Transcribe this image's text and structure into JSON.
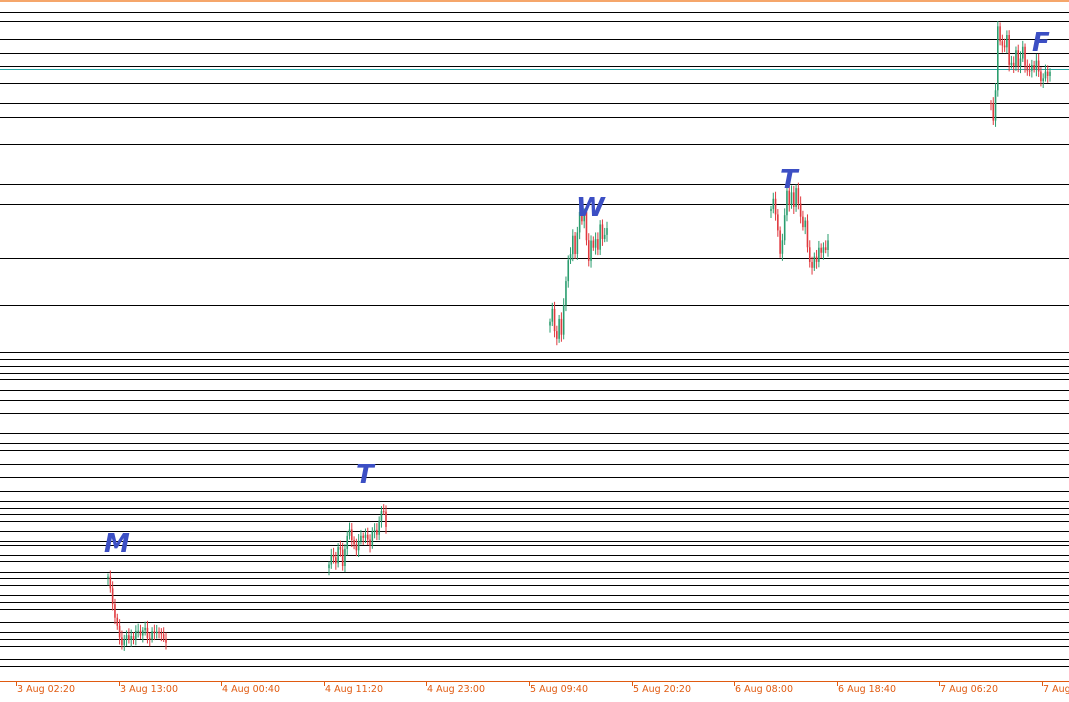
{
  "chart_data": {
    "type": "candlestick",
    "x_tick_labels": [
      "3 Aug 02:20",
      "3 Aug 13:00",
      "4 Aug 00:40",
      "4 Aug 11:20",
      "4 Aug 23:00",
      "5 Aug 09:40",
      "5 Aug 20:20",
      "6 Aug 08:00",
      "6 Aug 18:40",
      "7 Aug 06:20",
      "7 Aug"
    ],
    "day_labels": [
      {
        "text": "M",
        "anchor": "3 Aug 13:00"
      },
      {
        "text": "T",
        "anchor": "4 Aug 11:20"
      },
      {
        "text": "W",
        "anchor": "5 Aug 09:40"
      },
      {
        "text": "T",
        "anchor": "6 Aug 08:00"
      },
      {
        "text": "F",
        "anchor": "7 Aug 06:20"
      }
    ],
    "ylim": [
      0,
      100
    ],
    "horizontal_levels": [
      98.5,
      97.2,
      94.5,
      92.5,
      90.5,
      88.0,
      85.0,
      83.0,
      79.0,
      73.0,
      70.0,
      62.0,
      55.0,
      48.0,
      47.0,
      46.0,
      45.0,
      44.0,
      42.5,
      41.0,
      39.0,
      36.0,
      34.5,
      33.5,
      31.5,
      29.5,
      27.5,
      26.0,
      25.0,
      24.0,
      23.0,
      21.5,
      20.0,
      19.5,
      18.0,
      17.0,
      15.5,
      14.5,
      13.5,
      12.0,
      11.0,
      10.0,
      8.0,
      6.5,
      5.5,
      4.5,
      2.5,
      1.5
    ],
    "current_price_level": 90.0,
    "segments": [
      {
        "day": "M",
        "points": [
          [
            0.0,
            14.5
          ],
          [
            0.05,
            12.0
          ],
          [
            0.1,
            10.0
          ],
          [
            0.15,
            8.0
          ],
          [
            0.2,
            5.5
          ],
          [
            0.25,
            4.5
          ],
          [
            0.3,
            6.0
          ],
          [
            0.35,
            5.0
          ],
          [
            0.4,
            6.5
          ],
          [
            0.45,
            5.5
          ],
          [
            0.5,
            7.0
          ],
          [
            0.55,
            6.0
          ],
          [
            0.6,
            6.5
          ],
          [
            0.65,
            7.0
          ],
          [
            0.7,
            5.5
          ],
          [
            0.75,
            6.5
          ],
          [
            0.8,
            6.0
          ],
          [
            0.85,
            6.8
          ],
          [
            0.9,
            6.0
          ],
          [
            0.95,
            5.8
          ],
          [
            1.0,
            5.5
          ]
        ]
      },
      {
        "day": "T",
        "points": [
          [
            0.0,
            16.0
          ],
          [
            0.06,
            18.5
          ],
          [
            0.12,
            17.0
          ],
          [
            0.18,
            20.0
          ],
          [
            0.24,
            16.5
          ],
          [
            0.3,
            19.5
          ],
          [
            0.36,
            22.0
          ],
          [
            0.42,
            20.0
          ],
          [
            0.48,
            18.5
          ],
          [
            0.54,
            21.0
          ],
          [
            0.6,
            20.0
          ],
          [
            0.66,
            21.5
          ],
          [
            0.72,
            19.5
          ],
          [
            0.78,
            22.0
          ],
          [
            0.84,
            21.0
          ],
          [
            0.9,
            23.5
          ],
          [
            0.95,
            25.5
          ],
          [
            1.0,
            22.5
          ]
        ]
      },
      {
        "day": "W",
        "points": [
          [
            0.0,
            52.0
          ],
          [
            0.04,
            54.5
          ],
          [
            0.08,
            51.5
          ],
          [
            0.12,
            50.0
          ],
          [
            0.16,
            53.0
          ],
          [
            0.2,
            51.0
          ],
          [
            0.24,
            55.0
          ],
          [
            0.28,
            58.0
          ],
          [
            0.32,
            61.5
          ],
          [
            0.36,
            63.0
          ],
          [
            0.4,
            65.5
          ],
          [
            0.44,
            62.5
          ],
          [
            0.48,
            66.0
          ],
          [
            0.52,
            69.0
          ],
          [
            0.56,
            67.0
          ],
          [
            0.6,
            68.5
          ],
          [
            0.64,
            65.0
          ],
          [
            0.68,
            62.0
          ],
          [
            0.72,
            64.5
          ],
          [
            0.76,
            63.5
          ],
          [
            0.8,
            65.0
          ],
          [
            0.84,
            63.0
          ],
          [
            0.88,
            66.5
          ],
          [
            0.92,
            65.0
          ],
          [
            0.96,
            66.0
          ],
          [
            1.0,
            66.5
          ]
        ]
      },
      {
        "day": "T",
        "points": [
          [
            0.0,
            69.0
          ],
          [
            0.04,
            71.0
          ],
          [
            0.08,
            68.5
          ],
          [
            0.12,
            66.0
          ],
          [
            0.16,
            63.0
          ],
          [
            0.2,
            65.0
          ],
          [
            0.24,
            68.0
          ],
          [
            0.28,
            71.5
          ],
          [
            0.32,
            70.0
          ],
          [
            0.36,
            72.0
          ],
          [
            0.4,
            69.5
          ],
          [
            0.44,
            72.5
          ],
          [
            0.48,
            70.5
          ],
          [
            0.52,
            68.0
          ],
          [
            0.56,
            66.0
          ],
          [
            0.6,
            67.5
          ],
          [
            0.64,
            64.0
          ],
          [
            0.68,
            61.5
          ],
          [
            0.72,
            60.5
          ],
          [
            0.76,
            62.5
          ],
          [
            0.8,
            61.5
          ],
          [
            0.84,
            63.0
          ],
          [
            0.88,
            62.5
          ],
          [
            0.92,
            64.0
          ],
          [
            0.96,
            63.5
          ],
          [
            1.0,
            64.5
          ]
        ]
      },
      {
        "day": "F",
        "points": [
          [
            0.0,
            85.0
          ],
          [
            0.03,
            83.0
          ],
          [
            0.06,
            81.0
          ],
          [
            0.09,
            91.0
          ],
          [
            0.12,
            97.5
          ],
          [
            0.15,
            95.0
          ],
          [
            0.18,
            93.0
          ],
          [
            0.21,
            94.5
          ],
          [
            0.24,
            92.0
          ],
          [
            0.27,
            95.0
          ],
          [
            0.3,
            91.5
          ],
          [
            0.33,
            89.0
          ],
          [
            0.36,
            92.5
          ],
          [
            0.39,
            90.0
          ],
          [
            0.42,
            93.5
          ],
          [
            0.45,
            91.5
          ],
          [
            0.48,
            89.5
          ],
          [
            0.51,
            92.0
          ],
          [
            0.54,
            93.0
          ],
          [
            0.57,
            90.5
          ],
          [
            0.6,
            91.5
          ],
          [
            0.63,
            88.5
          ],
          [
            0.66,
            90.0
          ],
          [
            0.69,
            91.0
          ],
          [
            0.72,
            89.5
          ],
          [
            0.75,
            92.0
          ],
          [
            0.78,
            90.5
          ],
          [
            0.81,
            89.0
          ],
          [
            0.84,
            88.0
          ],
          [
            0.87,
            89.5
          ],
          [
            0.9,
            88.5
          ],
          [
            0.93,
            90.0
          ],
          [
            0.96,
            89.0
          ],
          [
            1.0,
            90.0
          ]
        ]
      }
    ],
    "colors": {
      "up": "#2a9d6e",
      "down": "#e0393e",
      "level_line": "#000000",
      "current_price": "#2aa6a6",
      "top_border": "#f5a66b",
      "axis": "#e05a10",
      "day_label": "#3c4fc4",
      "background": "#ffffff"
    }
  }
}
